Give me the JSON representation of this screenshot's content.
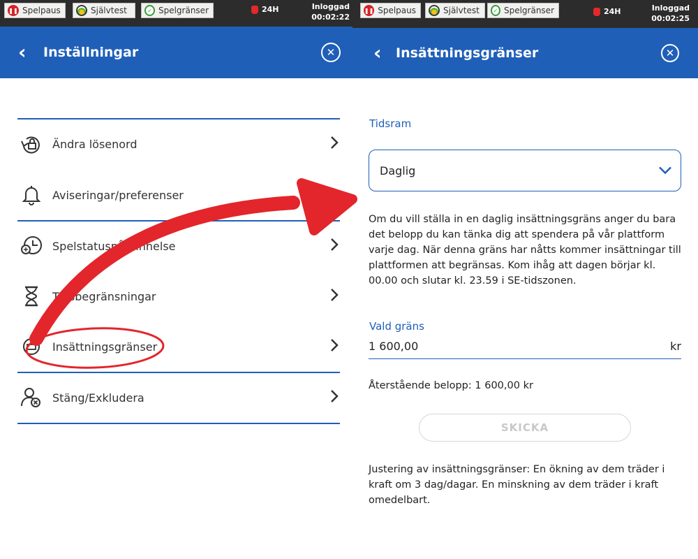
{
  "topbar_left": {
    "spelpaus": "Spelpaus",
    "sjalvtest": "Självtest",
    "spelgranser": "Spelgränser",
    "badge_24h": "24H",
    "login_status": "Inloggad",
    "session_time": "00:02:22"
  },
  "topbar_right": {
    "spelpaus": "Spelpaus",
    "sjalvtest": "Självtest",
    "spelgranser": "Spelgränser",
    "badge_24h": "24H",
    "login_status": "Inloggad",
    "session_time": "00:02:25"
  },
  "settings": {
    "back_glyph": "‹",
    "title": "Inställningar",
    "close_glyph": "✕",
    "menu": [
      {
        "label": "Ändra lösenord",
        "icon": "lock-rotate-icon"
      },
      {
        "label": "Aviseringar/preferenser",
        "icon": "bell-icon"
      },
      {
        "label": "Spelstatuspåminnelse",
        "icon": "clock-icon"
      },
      {
        "label": "Tidsbegränsningar",
        "icon": "hourglass-icon"
      },
      {
        "label": "Insättningsgränser",
        "icon": "deposit-icon"
      },
      {
        "label": "Stäng/Exkludera",
        "icon": "user-exclude-icon"
      }
    ]
  },
  "deposit": {
    "back_glyph": "‹",
    "title": "Insättningsgränser",
    "close_glyph": "✕",
    "timeframe_label": "Tidsram",
    "timeframe_value": "Daglig",
    "description": "Om du vill ställa in en daglig insättningsgräns anger du bara det belopp du kan tänka dig att spendera på vår plattform varje dag. När denna gräns har nåtts kommer insättningar till plattformen att begränsas. Kom ihåg att dagen börjar kl. 00.00 och slutar kl. 23.59 i SE-tidszonen.",
    "limit_label": "Vald gräns",
    "limit_value": "1 600,00",
    "currency": "kr",
    "remaining": "Återstående belopp: 1 600,00 kr",
    "submit_label": "SKICKA",
    "adjust_note": "Justering av insättningsgränser: En ökning av dem träder i kraft om 3 dag/dagar. En minskning av dem träder i kraft omedelbart."
  },
  "colors": {
    "header_blue": "#1f5fb8",
    "annotation_red": "#e2262b"
  }
}
